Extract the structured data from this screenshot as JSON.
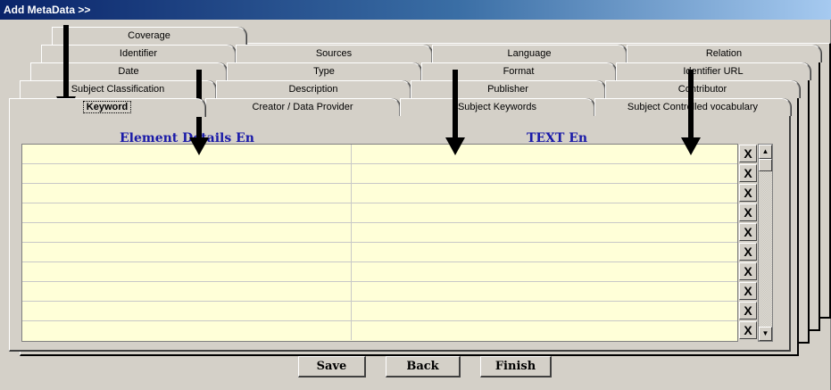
{
  "window": {
    "title": "Add MetaData >>"
  },
  "tabs": {
    "row1": [
      "Coverage"
    ],
    "row2": [
      "Identifier",
      "Sources",
      "Language",
      "Relation"
    ],
    "row3": [
      "Date",
      "Type",
      "Format",
      "Identifier URL"
    ],
    "row4": [
      "Subject Classification",
      "Description",
      "Publisher",
      "Contributor"
    ],
    "row5": [
      "Keyword",
      "Creator / Data Provider",
      "Subject Keywords",
      "Subject Controlled vocabulary"
    ],
    "active": "Keyword"
  },
  "grid": {
    "columns": [
      "Element Details En",
      "TEXT En"
    ],
    "row_count": 10,
    "delete_label": "X"
  },
  "actions": {
    "save": "Save",
    "back": "Back",
    "finish": "Finish"
  }
}
